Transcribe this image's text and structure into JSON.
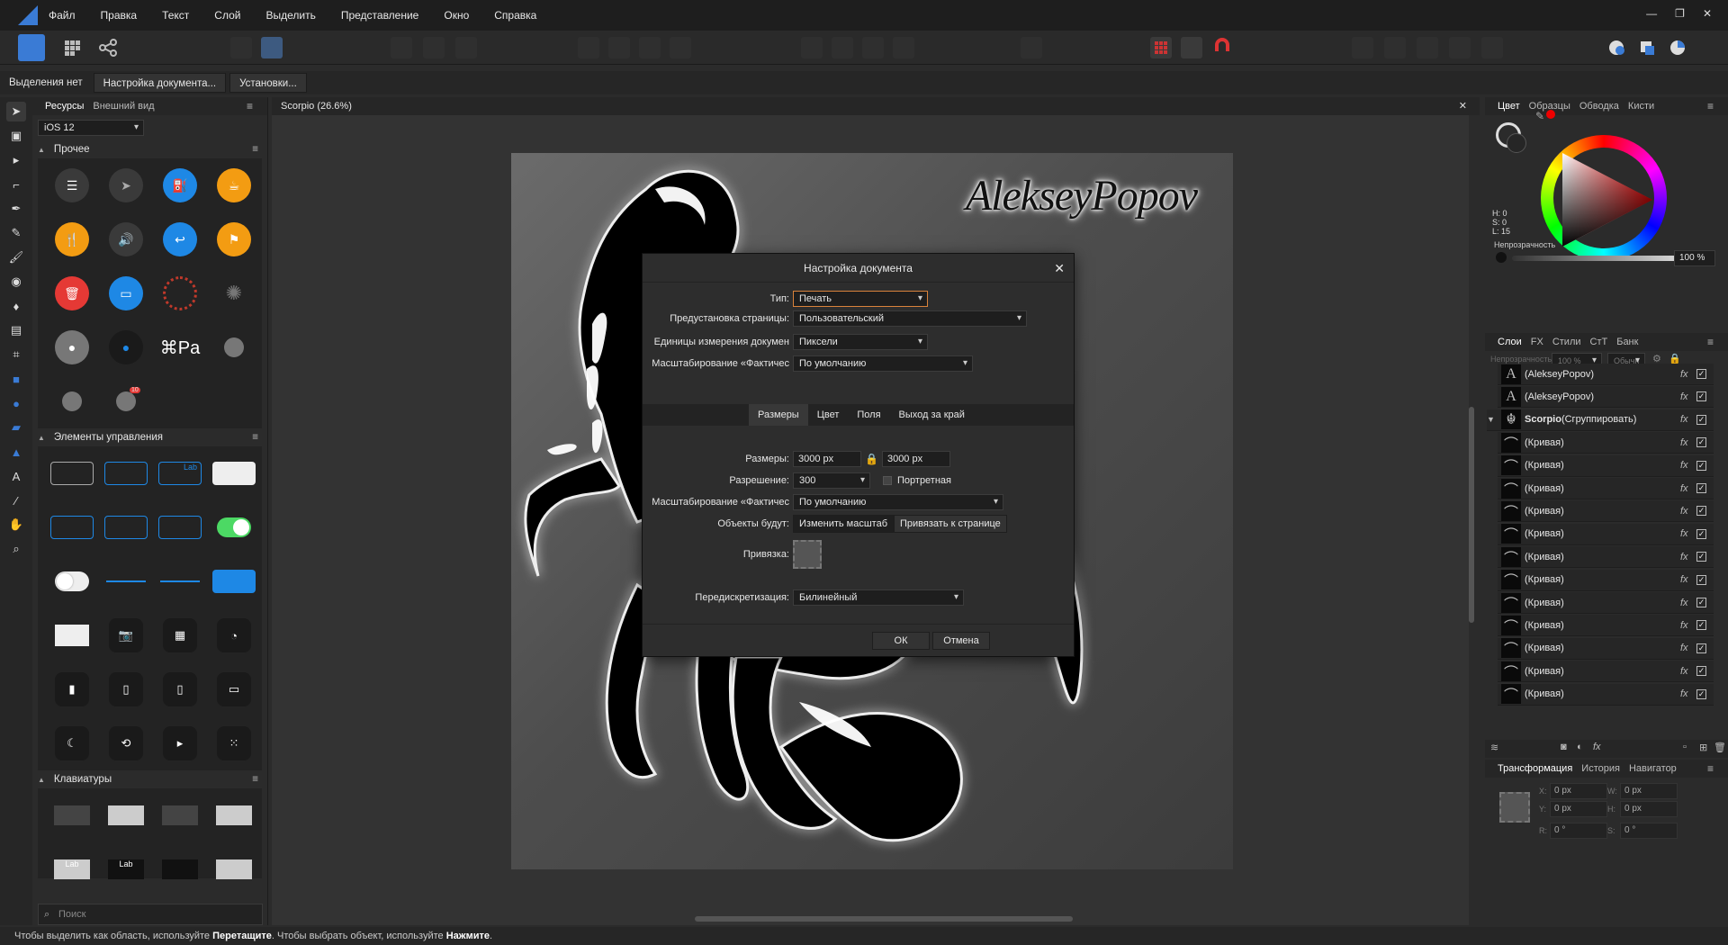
{
  "menubar": {
    "items": [
      "Файл",
      "Правка",
      "Текст",
      "Слой",
      "Выделить",
      "Представление",
      "Окно",
      "Справка"
    ]
  },
  "context": {
    "selection": "Выделения нет",
    "doc_setup": "Настройка документа...",
    "settings": "Установки..."
  },
  "assets": {
    "tabs": [
      "Ресурсы",
      "Внешний вид"
    ],
    "preset": "iOS 12",
    "sections": [
      "Прочее",
      "Элементы управления",
      "Клавиатуры"
    ],
    "search_placeholder": "Поиск",
    "apple_pay_text": "Pa",
    "ctrl_label_text": "Lab",
    "kb_label_text": "Lab",
    "badge_count": "10"
  },
  "document": {
    "tab_title": "Scorpio (26.6%)",
    "signature": "AlekseyPopov"
  },
  "dialog": {
    "title": "Настройка документа",
    "type_label": "Тип:",
    "type_value": "Печать",
    "page_preset_label": "Предустановка страницы:",
    "page_preset_value": "Пользовательский",
    "units_label": "Единицы измерения докумен",
    "units_value": "Пиксели",
    "scale_label": "Масштабирование «Фактичес",
    "scale_value": "По умолчанию",
    "tabs": [
      "Размеры",
      "Цвет",
      "Поля",
      "Выход за край"
    ],
    "size_label": "Размеры:",
    "width": "3000 px",
    "height": "3000 px",
    "resolution_label": "Разрешение:",
    "resolution": "300",
    "portrait_label": "Портретная",
    "scale2_label": "Масштабирование «Фактичес",
    "scale2_value": "По умолчанию",
    "objects_label": "Объекты будут:",
    "objects_opt1": "Изменить масштаб",
    "objects_opt2": "Привязать к странице",
    "anchor_label": "Привязка:",
    "resample_label": "Передискретизация:",
    "resample_value": "Билинейный",
    "ok": "ОК",
    "cancel": "Отмена"
  },
  "color_panel": {
    "tabs": [
      "Цвет",
      "Образцы",
      "Обводка",
      "Кисти"
    ],
    "h": "H: 0",
    "s": "S: 0",
    "l": "L: 15",
    "opacity_label": "Непрозрачность",
    "opacity_value": "100 %"
  },
  "layers_panel": {
    "tabs": [
      "Слои",
      "FX",
      "Стили",
      "СтТ",
      "Банк"
    ],
    "opacity_label": "Непрозрачность:",
    "opacity_value": "100 %",
    "blend": "Обычн",
    "layers": [
      {
        "name": "(AlekseyPopov)",
        "kind": "text"
      },
      {
        "name": "(AlekseyPopov)",
        "kind": "text"
      },
      {
        "name": "Scorpio",
        "suffix": " (Сгруппировать)",
        "kind": "group"
      },
      {
        "name": "(Кривая)",
        "kind": "curve"
      },
      {
        "name": "(Кривая)",
        "kind": "curve"
      },
      {
        "name": "(Кривая)",
        "kind": "curve"
      },
      {
        "name": "(Кривая)",
        "kind": "curve"
      },
      {
        "name": "(Кривая)",
        "kind": "curve"
      },
      {
        "name": "(Кривая)",
        "kind": "curve"
      },
      {
        "name": "(Кривая)",
        "kind": "curve"
      },
      {
        "name": "(Кривая)",
        "kind": "curve"
      },
      {
        "name": "(Кривая)",
        "kind": "curve"
      },
      {
        "name": "(Кривая)",
        "kind": "curve"
      },
      {
        "name": "(Кривая)",
        "kind": "curve"
      },
      {
        "name": "(Кривая)",
        "kind": "curve"
      }
    ]
  },
  "transform_panel": {
    "tabs": [
      "Трансформация",
      "История",
      "Навигатор"
    ],
    "x": "0 px",
    "y": "0 px",
    "w": "0 px",
    "h": "0 px",
    "r": "0 °",
    "s": "0 °",
    "x_label": "X:",
    "y_label": "Y:",
    "w_label": "W:",
    "h_label": "H:",
    "r_label": "R:",
    "s_label": "S:"
  },
  "status": {
    "p1": "Чтобы выделить как область, используйте ",
    "b1": "Перетащите",
    "p2": ". Чтобы выбрать объект, используйте ",
    "b2": "Нажмите",
    "p3": "."
  },
  "icons": {
    "app_logo": "affinity-designer-logo",
    "scorpio_art": "scorpion-illustration"
  }
}
